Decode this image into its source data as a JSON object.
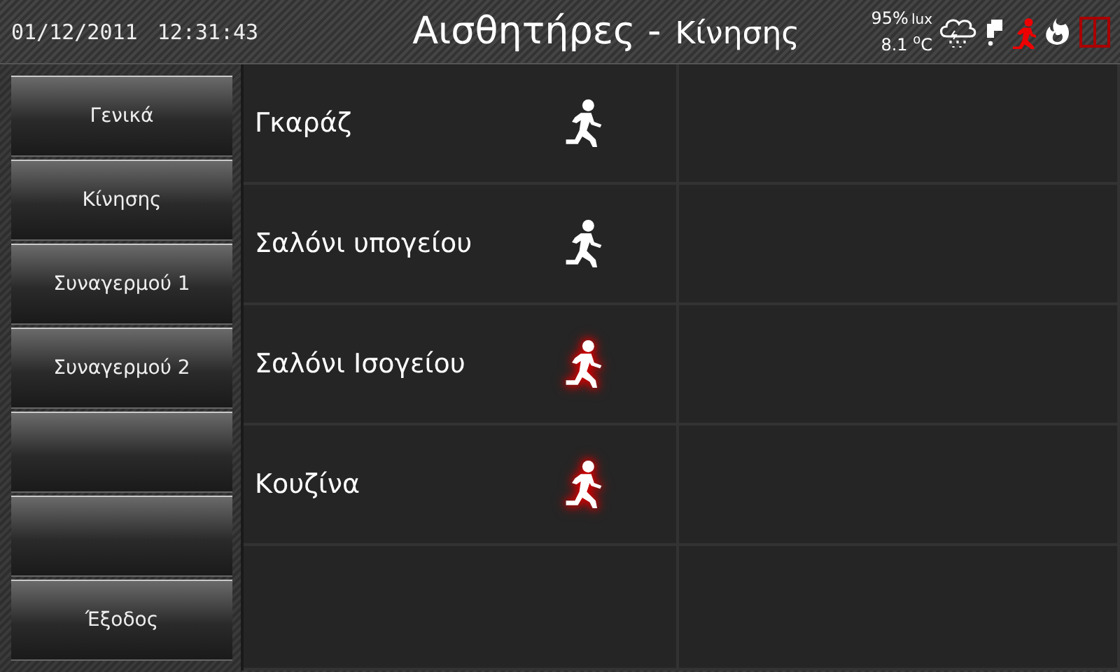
{
  "header": {
    "date": "01/12/2011",
    "time": "12:31:43",
    "title": "Αισθητήρες -",
    "subtitle": "Κίνησης",
    "light": "95%",
    "light_unit": "lux",
    "temperature": "8.1 $^{o}$C",
    "status_icons": [
      {
        "kind": "weather",
        "alert": false
      },
      {
        "kind": "water",
        "alert": false
      },
      {
        "kind": "motion",
        "alert": true
      },
      {
        "kind": "fire",
        "alert": false
      },
      {
        "kind": "door",
        "alert": true
      }
    ]
  },
  "menu": [
    {
      "kind": "label",
      "label": "Γενικά"
    },
    {
      "kind": "label",
      "label": "Κίνησης"
    },
    {
      "kind": "label",
      "label": "Συναγερμού 1"
    },
    {
      "kind": "label",
      "label": "Συναγερμού 2"
    },
    {
      "kind": "blank"
    },
    {
      "kind": "blank"
    },
    {
      "kind": "label",
      "label": "Έξοδος"
    }
  ],
  "sensors": [
    {
      "name": "Γκαράζ",
      "active": false
    },
    {
      "name": "Σαλόνι υπογείου",
      "active": false
    },
    {
      "name": "Σαλόνι Ισογείου",
      "active": true
    },
    {
      "name": "Κουζίνα",
      "active": true
    }
  ]
}
